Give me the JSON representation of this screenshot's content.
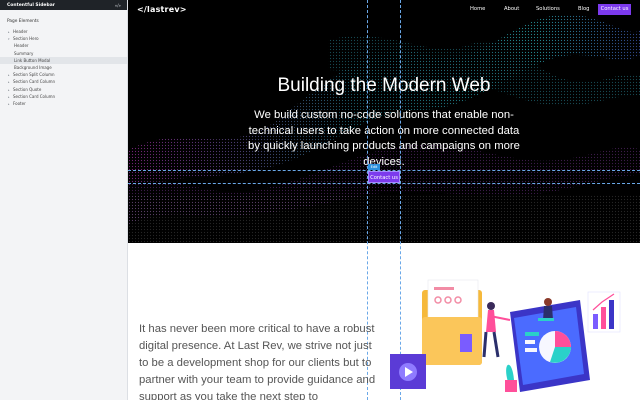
{
  "sidebar": {
    "title": "Contentful Sidebar",
    "arrows": "«/»",
    "heading": "Page Elements",
    "items": [
      {
        "label": "Header",
        "level": 1
      },
      {
        "label": "Section Hero",
        "level": 1
      },
      {
        "label": "Header",
        "level": 2
      },
      {
        "label": "Summary",
        "level": 2
      },
      {
        "label": "Link Button Modal",
        "level": 2,
        "selected": true
      },
      {
        "label": "Background Image",
        "level": 2
      },
      {
        "label": "Section Split Column",
        "level": 1
      },
      {
        "label": "Section Card Column",
        "level": 1
      },
      {
        "label": "Section Quote",
        "level": 1
      },
      {
        "label": "Section Card Column",
        "level": 1
      },
      {
        "label": "Footer",
        "level": 1
      }
    ]
  },
  "nav": {
    "logo": "</lastrev>",
    "links": [
      "Home",
      "About",
      "Solutions",
      "Blog"
    ],
    "cta": "Contact us"
  },
  "hero": {
    "title": "Building the Modern Web",
    "body": "We build custom no-code solutions that enable non-technical users to take action on more connected data by quickly launching products and campaigns on more devices.",
    "edit_badge": "Edit",
    "cta": "Contact us"
  },
  "intro": {
    "text": "It has never been more critical to have a robust digital presence. At Last Rev, we strive not just to be a development shop for our clients but to partner with your team to provide guidance and support as you take the next step to"
  },
  "colors": {
    "accent": "#7c3aed",
    "guide": "#6aa8e8",
    "hero_bg": "#000000"
  }
}
